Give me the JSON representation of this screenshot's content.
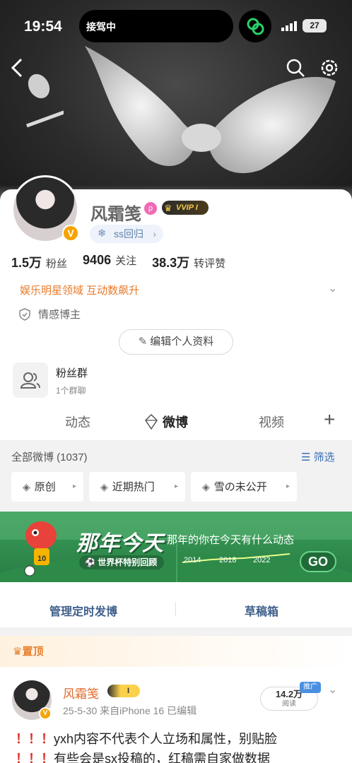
{
  "status": {
    "time": "19:54",
    "island_text": "接驾中",
    "battery": "27"
  },
  "profile": {
    "name": "风霜笺",
    "vip_label": "VVIP I",
    "tag": "ss回归",
    "stats": [
      {
        "num": "1.5万",
        "label": "粉丝"
      },
      {
        "num": "9406",
        "label": "关注"
      },
      {
        "num": "38.3万",
        "label": "转评赞"
      }
    ],
    "domain": "娱乐明星领域 互动数飙升",
    "identity": "情感博主",
    "edit_label": "编辑个人资料",
    "fan_group": {
      "title": "粉丝群",
      "sub": "1个群聊"
    }
  },
  "tabs": [
    "动态",
    "微博",
    "视频"
  ],
  "feed": {
    "all_label": "全部微博 (1037)",
    "filter_label": "筛选",
    "chips": [
      "原创",
      "近期热门",
      "雪の未公开"
    ]
  },
  "promo": {
    "title": "那年今天",
    "subtitle": "那年的你在今天有什么动态",
    "badge": "世界杯特别回顾",
    "years": [
      "2014",
      "2018",
      "2022"
    ],
    "go": "GO"
  },
  "actions": {
    "manage": "管理定时发博",
    "draft": "草稿箱"
  },
  "pinned": {
    "label": "置顶",
    "name": "风霜笺",
    "meta": "25-5-30  来自iPhone 16  已编辑",
    "views_num": "14.2万",
    "views_label": "阅读",
    "ad_tag": "推广",
    "text_line1": "yxh内容不代表个人立场和属性，别贴脸",
    "text_line2": "有些会是sx投稿的，红稿需自家做数据"
  }
}
